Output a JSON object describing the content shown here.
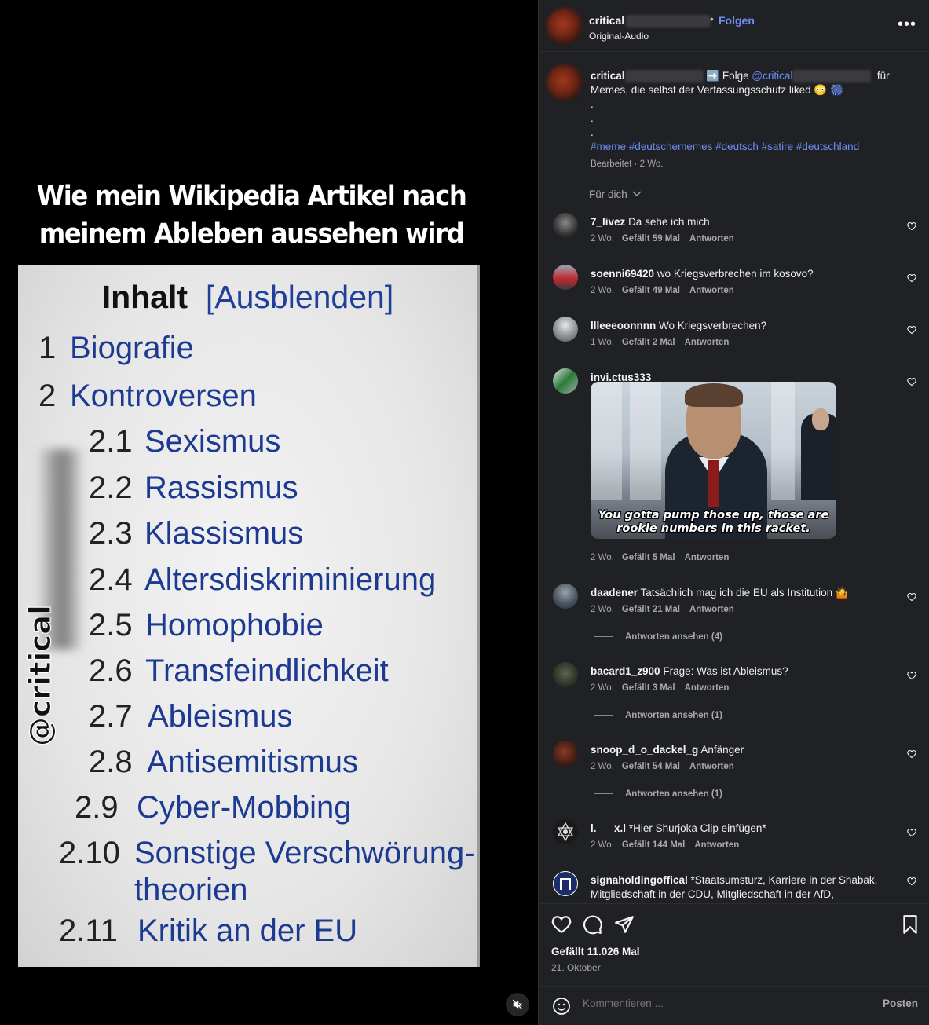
{
  "media": {
    "caption_line1": "Wie mein Wikipedia Artikel nach",
    "caption_line2": "meinem Ableben aussehen wird",
    "toc_title": "Inhalt",
    "toc_hide": "[Ausblenden]",
    "watermark": "@critical",
    "toc": [
      {
        "num": "1",
        "label": "Biografie"
      },
      {
        "num": "2",
        "label": "Kontroversen"
      },
      {
        "num": "2.1",
        "label": "Sexismus"
      },
      {
        "num": "2.2",
        "label": "Rassismus"
      },
      {
        "num": "2.3",
        "label": "Klassismus"
      },
      {
        "num": "2.4",
        "label": "Altersdiskriminierung"
      },
      {
        "num": "2.5",
        "label": "Homophobie"
      },
      {
        "num": "2.6",
        "label": "Transfeindlichkeit"
      },
      {
        "num": "2.7",
        "label": "Ableismus"
      },
      {
        "num": "2.8",
        "label": "Antisemitismus"
      },
      {
        "num": "2.9",
        "label": "Cyber-Mobbing"
      },
      {
        "num": "2.10",
        "label": "Sonstige Verschwörung-"
      },
      {
        "num": "",
        "label": "theorien"
      },
      {
        "num": "2.11",
        "label": "Kritik an der EU"
      }
    ]
  },
  "header": {
    "username": "critical",
    "separator": "•",
    "follow": "Folgen",
    "audio": "Original-Audio",
    "more": "•••"
  },
  "post_caption": {
    "username": "critical",
    "arrow": "➡️",
    "follow_text": "Folge",
    "mention": "@critical",
    "for_text": "für",
    "line2": "Memes, die selbst der Verfassungsschutz liked 😳 🎆",
    "dots": [
      ".",
      ".",
      "."
    ],
    "hashtags": "#meme #deutschememes #deutsch #satire #deutschland",
    "meta": "Bearbeitet · 2 Wo."
  },
  "filter": {
    "label": "Für dich"
  },
  "comments": [
    {
      "user": "7_livez",
      "text": "Da sehe ich mich",
      "time": "2 Wo.",
      "likes": "Gefällt 59 Mal",
      "reply": "Antworten"
    },
    {
      "user": "soenni69420",
      "text": "wo Kriegsverbrechen im kosovo?",
      "time": "2 Wo.",
      "likes": "Gefällt 49 Mal",
      "reply": "Antworten"
    },
    {
      "user": "llleeeoonnnn",
      "text": "Wo Kriegsverbrechen?",
      "time": "1 Wo.",
      "likes": "Gefällt 2 Mal",
      "reply": "Antworten"
    },
    {
      "user": "invi.ctus333",
      "text": "",
      "time": "2 Wo.",
      "likes": "Gefällt 5 Mal",
      "reply": "Antworten",
      "gif_subtitle": "You gotta pump those up, those are rookie numbers in this racket."
    },
    {
      "user": "daadener",
      "text": "Tatsächlich mag ich die EU als Institution 🤷",
      "time": "2 Wo.",
      "likes": "Gefällt 21 Mal",
      "reply": "Antworten",
      "view_replies": "Antworten ansehen (4)"
    },
    {
      "user": "bacard1_z900",
      "text": "Frage: Was ist Ableismus?",
      "time": "2 Wo.",
      "likes": "Gefällt 3 Mal",
      "reply": "Antworten",
      "view_replies": "Antworten ansehen (1)"
    },
    {
      "user": "snoop_d_o_dackel_g",
      "text": "Anfänger",
      "time": "2 Wo.",
      "likes": "Gefällt 54 Mal",
      "reply": "Antworten",
      "view_replies": "Antworten ansehen (1)"
    },
    {
      "user": "l.___x.l",
      "text": "*Hier Shurjoka Clip einfügen*",
      "time": "2 Wo.",
      "likes": "Gefällt 144 Mal",
      "reply": "Antworten"
    },
    {
      "user": "signaholdingoffical",
      "text": "*Staatsumsturz, Karriere in der Shabak, Mitgliedschaft in der CDU, Mitgliedschaft in der AfD,",
      "time": "",
      "likes": "",
      "reply": ""
    }
  ],
  "footer": {
    "likes": "Gefällt 11.026 Mal",
    "date": "21. Oktober",
    "comment_placeholder": "Kommentieren ...",
    "post_label": "Posten"
  },
  "colors": {
    "accent": "#6c8ef6",
    "panel_bg": "#202125",
    "wiki_link": "#1d3a93"
  }
}
